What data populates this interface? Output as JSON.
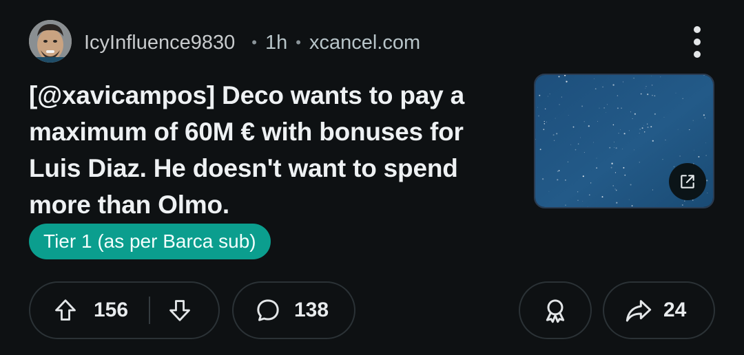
{
  "post": {
    "author": "IcyInfluence9830",
    "age": "1h",
    "source_domain": "xcancel.com",
    "separator": "•",
    "title": "[@xavicampos] Deco wants to pay a maximum of 60M € with bonuses for Luis Diaz. He doesn't want to spend more than Olmo.",
    "flair": "Tier 1 (as per Barca sub)"
  },
  "actions": {
    "upvotes": "156",
    "comments": "138",
    "shares": "24"
  },
  "colors": {
    "background": "#0e1113",
    "flair_bg": "#0b9e8e",
    "pill_border": "#2b3236"
  },
  "icons": {
    "avatar": "user-avatar",
    "more": "more-vertical-icon",
    "thumbnail": "starfield-thumbnail",
    "external": "external-link-icon",
    "upvote": "upvote-arrow-icon",
    "downvote": "downvote-arrow-icon",
    "comment": "comment-bubble-icon",
    "award": "award-icon",
    "share": "share-arrow-icon"
  }
}
